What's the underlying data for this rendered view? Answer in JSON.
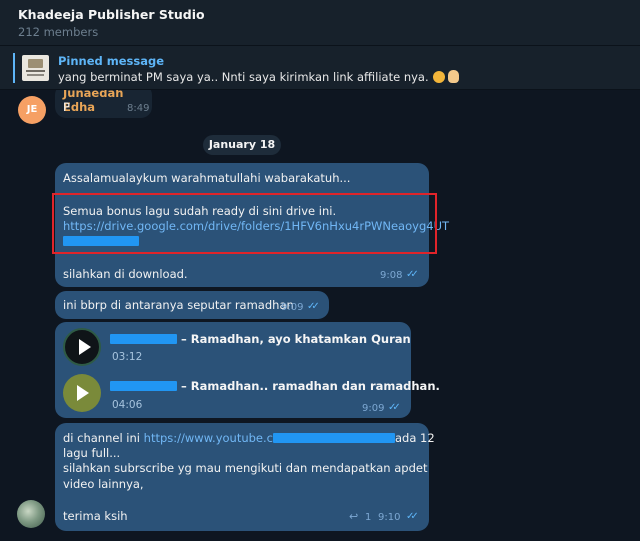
{
  "header": {
    "title": "Khadeeja Publisher Studio",
    "members": "212 members"
  },
  "pinned": {
    "label": "Pinned message",
    "text": "yang berminat PM saya ya.. Nnti saya kirimkan link affiliate nya."
  },
  "messages": {
    "junaedah": {
      "avatar_initials": "JE",
      "sender": "Junaedah Edha",
      "text": "P",
      "time": "8:49"
    },
    "date_separator": "January 18",
    "m1": {
      "greeting": "Assalamualaykum warahmatullahi wabarakatuh...",
      "bonus_text": "Semua bonus lagu sudah ready di sini drive ini.",
      "link": "https://drive.google.com/drive/folders/1HFV6nHxu4rPWNeaoyg4UT",
      "download_text": "silahkan di download.",
      "time": "9:08"
    },
    "m2": {
      "text": "ini bbrp di antaranya seputar ramadhan",
      "time": "9:09"
    },
    "m3": {
      "track1_title": "– Ramadhan, ayo khatamkan Quran",
      "track1_duration": "03:12",
      "track2_title": "– Ramadhan.. ramadhan dan ramadhan.",
      "track2_duration": "04:06",
      "time": "9:09"
    },
    "m4": {
      "line1_prefix": "di channel ini ",
      "line1_link": "https://www.youtube.c",
      "line1_suffix": "ada 12",
      "line2": "lagu full...",
      "line3": "silahkan subrscribe yg mau mengikuti dan mendapatkan apdet",
      "line4": "video lainnya,",
      "line5": "terima ksih",
      "replies": "1",
      "time": "9:10"
    }
  },
  "icons": {
    "pinned_thumb": "publisher-logo",
    "reply": "reply-arrow-icon",
    "read": "double-check-icon"
  },
  "colors": {
    "accent": "#5eb5f7",
    "outgoing_bubble": "#2b5278",
    "highlight_box": "#e0242a"
  }
}
